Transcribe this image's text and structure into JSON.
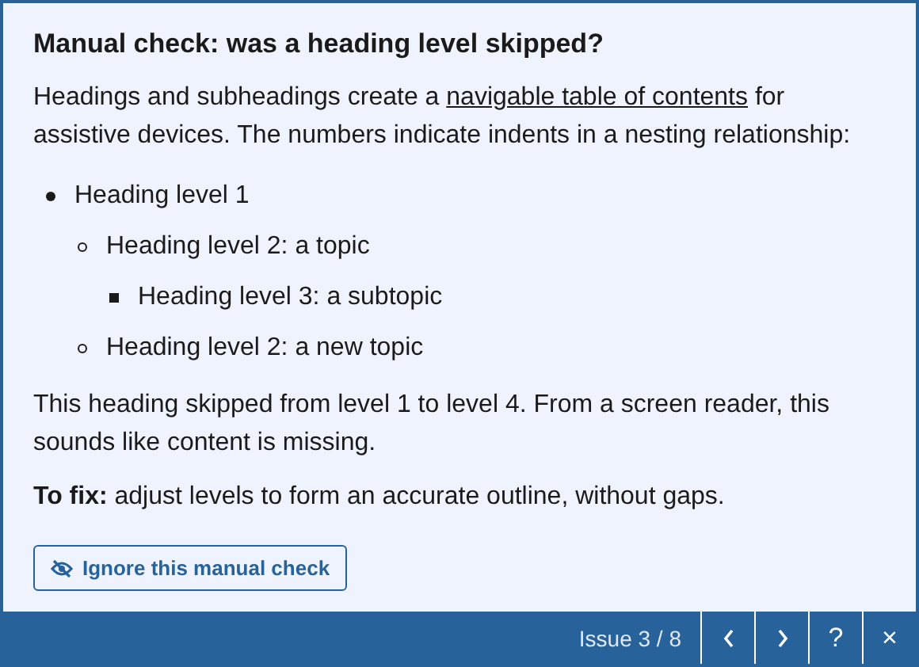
{
  "title": "Manual check: was a heading level skipped?",
  "intro": {
    "before": "Headings and subheadings create a",
    "link": "navigable table of contents",
    "after": "for assistive devices. The numbers indicate indents in a nesting relationship:"
  },
  "outline": [
    {
      "label": "Heading level 1",
      "children": [
        {
          "label": "Heading level 2: a topic",
          "children": [
            {
              "label": "Heading level 3: a subtopic"
            }
          ]
        },
        {
          "label": "Heading level 2: a new topic"
        }
      ]
    }
  ],
  "explanation": "This heading skipped from level 1 to level 4. From a screen reader, this sounds like content is missing.",
  "fix": "**To fix:** adjust levels to form an accurate outline, without gaps.",
  "ignore_button": "Ignore this manual check",
  "footer": {
    "counter": "Issue 3 / 8",
    "buttons": [
      {
        "kind": "prev"
      },
      {
        "kind": "next"
      },
      {
        "kind": "text",
        "label": "?"
      },
      {
        "kind": "text",
        "label": "×"
      }
    ]
  }
}
